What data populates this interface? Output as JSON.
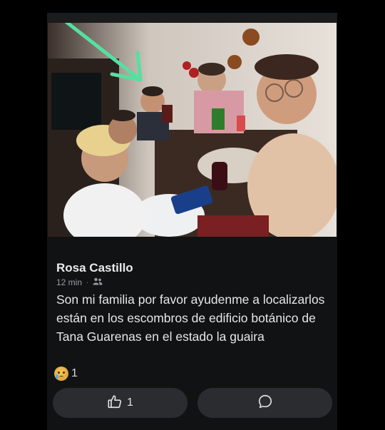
{
  "post": {
    "author": "Rosa Castillo",
    "time": "12 min",
    "separator": "·",
    "audience_icon": "friends-icon",
    "text": "Son mi familia por favor ayudenme a localizarlos están en los escombros de edificio botánico de Tana Guarenas en el estado la guaira",
    "reaction_emoji": "sad-crying-face-icon",
    "reaction_count": "1"
  },
  "actions": {
    "like_icon": "thumbs-up-icon",
    "like_count": "1",
    "comment_icon": "comment-bubble-icon"
  },
  "colors": {
    "background": "#000000",
    "card": "#111213",
    "button": "#2b2c2f",
    "arrow": "#55e0a0"
  }
}
